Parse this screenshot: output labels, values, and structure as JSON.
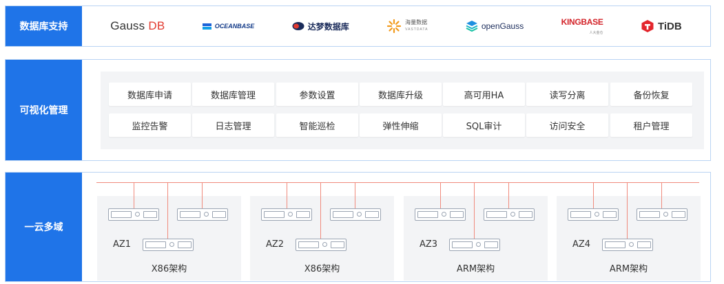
{
  "rows": {
    "db_support": {
      "label": "数据库支持"
    },
    "visual_mgmt": {
      "label": "可视化管理"
    },
    "multi_region": {
      "label": "一云多域"
    }
  },
  "logos": [
    {
      "id": "gaussdb",
      "text_a": "Gauss",
      "text_b": "DB"
    },
    {
      "id": "oceanbase",
      "text": "OCEANBASE"
    },
    {
      "id": "dameng",
      "text": "达梦数据库"
    },
    {
      "id": "haliang",
      "text": "海量数据",
      "sub": "VASTDATA"
    },
    {
      "id": "opengauss",
      "text": "openGauss"
    },
    {
      "id": "kingbase",
      "text": "KINGBASE",
      "sub": "人大金仓"
    },
    {
      "id": "tidb",
      "text": "TiDB"
    }
  ],
  "functions": [
    [
      "数据库申请",
      "数据库管理",
      "参数设置",
      "数据库升级",
      "高可用HA",
      "读写分离",
      "备份恢复"
    ],
    [
      "监控告警",
      "日志管理",
      "智能巡检",
      "弹性伸缩",
      "SQL审计",
      "访问安全",
      "租户管理"
    ]
  ],
  "zones": [
    {
      "az": "AZ1",
      "arch": "X86架构"
    },
    {
      "az": "AZ2",
      "arch": "X86架构"
    },
    {
      "az": "AZ3",
      "arch": "ARM架构"
    },
    {
      "az": "AZ4",
      "arch": "ARM架构"
    }
  ],
  "colors": {
    "label_bg": "#1f74e8",
    "border": "#b9d3f3",
    "panel": "#f3f4f6",
    "link": "#f08a7c"
  }
}
